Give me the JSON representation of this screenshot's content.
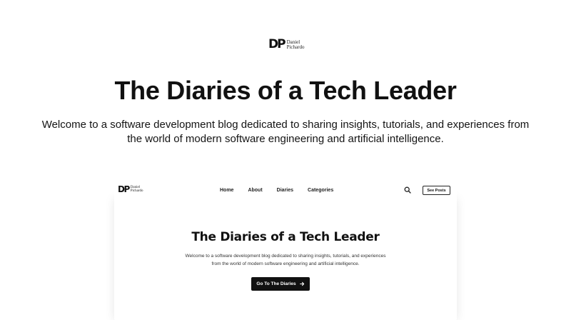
{
  "logo": {
    "mark": "DP",
    "line1": "Daniel",
    "line2": "Pichardo"
  },
  "hero": {
    "title": "The Diaries of a Tech Leader",
    "description": "Welcome to a software development blog dedicated to sharing insights, tutorials, and experiences from the world of modern software engineering and artificial intelligence."
  },
  "preview": {
    "nav": {
      "items": [
        {
          "label": "Home"
        },
        {
          "label": "About"
        },
        {
          "label": "Diaries"
        },
        {
          "label": "Categories"
        }
      ],
      "search_icon": "search-icon",
      "button_label": "See Posts"
    },
    "title": "The Diaries of a Tech Leader",
    "description": "Welcome to a software development blog dedicated to sharing insights, tutorials, and experiences from the world of modern software engineering and artificial intelligence.",
    "cta_label": "Go To The Diaries",
    "cta_icon": "arrow-right-icon"
  }
}
